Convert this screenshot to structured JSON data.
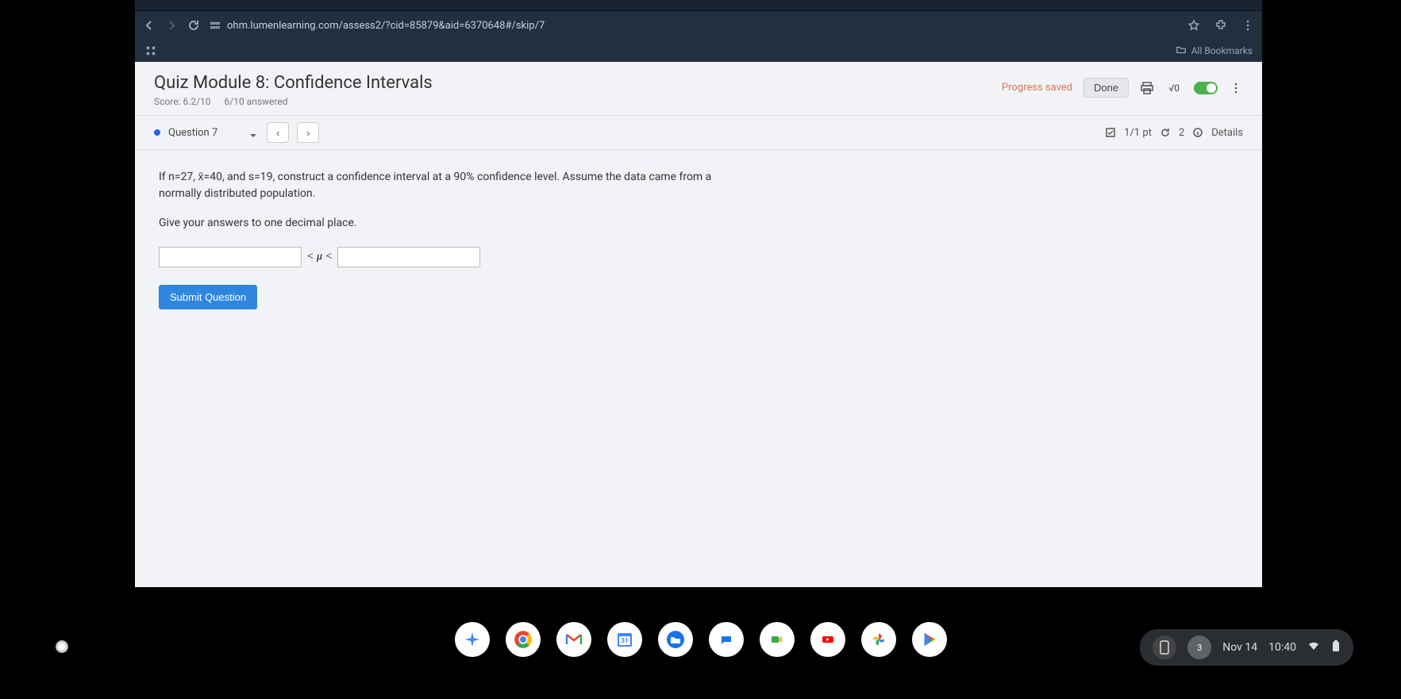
{
  "browser": {
    "url": "ohm.lumenlearning.com/assess2/?cid=85879&aid=6370648#/skip/7",
    "bookmarks_label": "All Bookmarks"
  },
  "header": {
    "title": "Quiz Module 8: Confidence Intervals",
    "score": "Score: 6.2/10",
    "answered": "6/10 answered",
    "progress": "Progress saved",
    "done": "Done",
    "sqrt": "√0"
  },
  "question_bar": {
    "label": "Question 7",
    "points": "1/1 pt",
    "attempts": "2",
    "details": "Details"
  },
  "question": {
    "text": "If n=27, x̄=40, and s=19, construct a confidence interval at a 90% confidence level. Assume the data came from a normally distributed population.",
    "instruction": "Give your answers to one decimal place.",
    "mu": "< μ <"
  },
  "actions": {
    "submit": "Submit Question"
  },
  "system": {
    "date": "Nov 14",
    "time": "10:40"
  }
}
